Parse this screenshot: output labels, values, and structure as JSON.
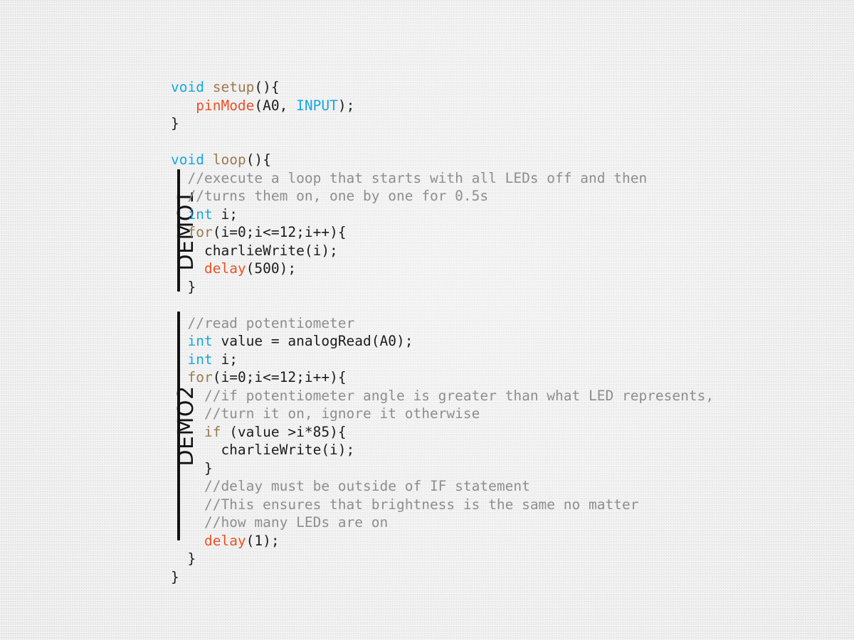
{
  "meta": {
    "background_color": "#e9e9e9",
    "palette": {
      "keyword": "#17a7e0",
      "function_name": "#9b7a52",
      "builtin_call": "#e85328",
      "comment": "#8e8e8e",
      "plain": "#1c1c1c",
      "bracket_bar": "#121212"
    }
  },
  "annotations": {
    "demo1": {
      "label": "DEMO1"
    },
    "demo2": {
      "label": "DEMO2"
    }
  },
  "code": {
    "language": "arduino",
    "lines": [
      {
        "id": "l1",
        "text": "void setup(){"
      },
      {
        "id": "l2",
        "text": "   pinMode(A0, INPUT);"
      },
      {
        "id": "l3",
        "text": "}"
      },
      {
        "id": "l4",
        "text": ""
      },
      {
        "id": "l5",
        "text": "void loop(){"
      },
      {
        "id": "l6",
        "text": "  //execute a loop that starts with all LEDs off and then"
      },
      {
        "id": "l7",
        "text": "  //turns them on, one by one for 0.5s"
      },
      {
        "id": "l8",
        "text": "  int i;"
      },
      {
        "id": "l9",
        "text": "  for(i=0;i<=12;i++){"
      },
      {
        "id": "l10",
        "text": "    charlieWrite(i);"
      },
      {
        "id": "l11",
        "text": "    delay(500);"
      },
      {
        "id": "l12",
        "text": "  }"
      },
      {
        "id": "l13",
        "text": ""
      },
      {
        "id": "l14",
        "text": "  //read potentiometer"
      },
      {
        "id": "l15",
        "text": "  int value = analogRead(A0);"
      },
      {
        "id": "l16",
        "text": "  int i;"
      },
      {
        "id": "l17",
        "text": "  for(i=0;i<=12;i++){"
      },
      {
        "id": "l18",
        "text": "    //if potentiometer angle is greater than what LED represents,"
      },
      {
        "id": "l19",
        "text": "    //turn it on, ignore it otherwise"
      },
      {
        "id": "l20",
        "text": "    if (value >i*85){"
      },
      {
        "id": "l21",
        "text": "      charlieWrite(i);"
      },
      {
        "id": "l22",
        "text": "    }"
      },
      {
        "id": "l23",
        "text": "    //delay must be outside of IF statement"
      },
      {
        "id": "l24",
        "text": "    //This ensures that brightness is the same no matter"
      },
      {
        "id": "l25",
        "text": "    //how many LEDs are on"
      },
      {
        "id": "l26",
        "text": "    delay(1);"
      },
      {
        "id": "l27",
        "text": "  }"
      },
      {
        "id": "l28",
        "text": "}"
      }
    ],
    "segments": {
      "l1": [
        {
          "t": "void",
          "c": "t-key"
        },
        {
          "t": " ",
          "c": "t-plain"
        },
        {
          "t": "setup",
          "c": "t-fn"
        },
        {
          "t": "(){",
          "c": "t-plain"
        }
      ],
      "l2": [
        {
          "t": "   ",
          "c": "t-plain"
        },
        {
          "t": "pinMode",
          "c": "t-call"
        },
        {
          "t": "(A0, ",
          "c": "t-plain"
        },
        {
          "t": "INPUT",
          "c": "t-key"
        },
        {
          "t": ");",
          "c": "t-plain"
        }
      ],
      "l3": [
        {
          "t": "}",
          "c": "t-plain"
        }
      ],
      "l4": [
        {
          "t": "",
          "c": "t-plain"
        }
      ],
      "l5": [
        {
          "t": "void",
          "c": "t-key"
        },
        {
          "t": " ",
          "c": "t-plain"
        },
        {
          "t": "loop",
          "c": "t-fn"
        },
        {
          "t": "(){",
          "c": "t-plain"
        }
      ],
      "l6": [
        {
          "t": "  //execute a loop that starts with all LEDs off and then",
          "c": "t-com"
        }
      ],
      "l7": [
        {
          "t": "  //turns them on, one by one for 0.5s",
          "c": "t-com"
        }
      ],
      "l8": [
        {
          "t": "  ",
          "c": "t-plain"
        },
        {
          "t": "int",
          "c": "t-key"
        },
        {
          "t": " i;",
          "c": "t-plain"
        }
      ],
      "l9": [
        {
          "t": "  ",
          "c": "t-plain"
        },
        {
          "t": "for",
          "c": "t-fn"
        },
        {
          "t": "(i=0;i<=12;i++){",
          "c": "t-plain"
        }
      ],
      "l10": [
        {
          "t": "    charlieWrite(i);",
          "c": "t-plain"
        }
      ],
      "l11": [
        {
          "t": "    ",
          "c": "t-plain"
        },
        {
          "t": "delay",
          "c": "t-call"
        },
        {
          "t": "(500);",
          "c": "t-plain"
        }
      ],
      "l12": [
        {
          "t": "  }",
          "c": "t-plain"
        }
      ],
      "l13": [
        {
          "t": "",
          "c": "t-plain"
        }
      ],
      "l14": [
        {
          "t": "  //read potentiometer",
          "c": "t-com"
        }
      ],
      "l15": [
        {
          "t": "  ",
          "c": "t-plain"
        },
        {
          "t": "int",
          "c": "t-key"
        },
        {
          "t": " value = analogRead(A0);",
          "c": "t-plain"
        }
      ],
      "l16": [
        {
          "t": "  ",
          "c": "t-plain"
        },
        {
          "t": "int",
          "c": "t-key"
        },
        {
          "t": " i;",
          "c": "t-plain"
        }
      ],
      "l17": [
        {
          "t": "  ",
          "c": "t-plain"
        },
        {
          "t": "for",
          "c": "t-fn"
        },
        {
          "t": "(i=0;i<=12;i++){",
          "c": "t-plain"
        }
      ],
      "l18": [
        {
          "t": "    //if potentiometer angle is greater than what LED represents,",
          "c": "t-com"
        }
      ],
      "l19": [
        {
          "t": "    //turn it on, ignore it otherwise",
          "c": "t-com"
        }
      ],
      "l20": [
        {
          "t": "    ",
          "c": "t-plain"
        },
        {
          "t": "if",
          "c": "t-fn"
        },
        {
          "t": " (value >i*85){",
          "c": "t-plain"
        }
      ],
      "l21": [
        {
          "t": "      charlieWrite(i);",
          "c": "t-plain"
        }
      ],
      "l22": [
        {
          "t": "    }",
          "c": "t-plain"
        }
      ],
      "l23": [
        {
          "t": "    //delay must be outside of IF statement",
          "c": "t-com"
        }
      ],
      "l24": [
        {
          "t": "    //This ensures that brightness is the same no matter",
          "c": "t-com"
        }
      ],
      "l25": [
        {
          "t": "    //how many LEDs are on",
          "c": "t-com"
        }
      ],
      "l26": [
        {
          "t": "    ",
          "c": "t-plain"
        },
        {
          "t": "delay",
          "c": "t-call"
        },
        {
          "t": "(1);",
          "c": "t-plain"
        }
      ],
      "l27": [
        {
          "t": "  }",
          "c": "t-plain"
        }
      ],
      "l28": [
        {
          "t": "}",
          "c": "t-plain"
        }
      ]
    }
  }
}
